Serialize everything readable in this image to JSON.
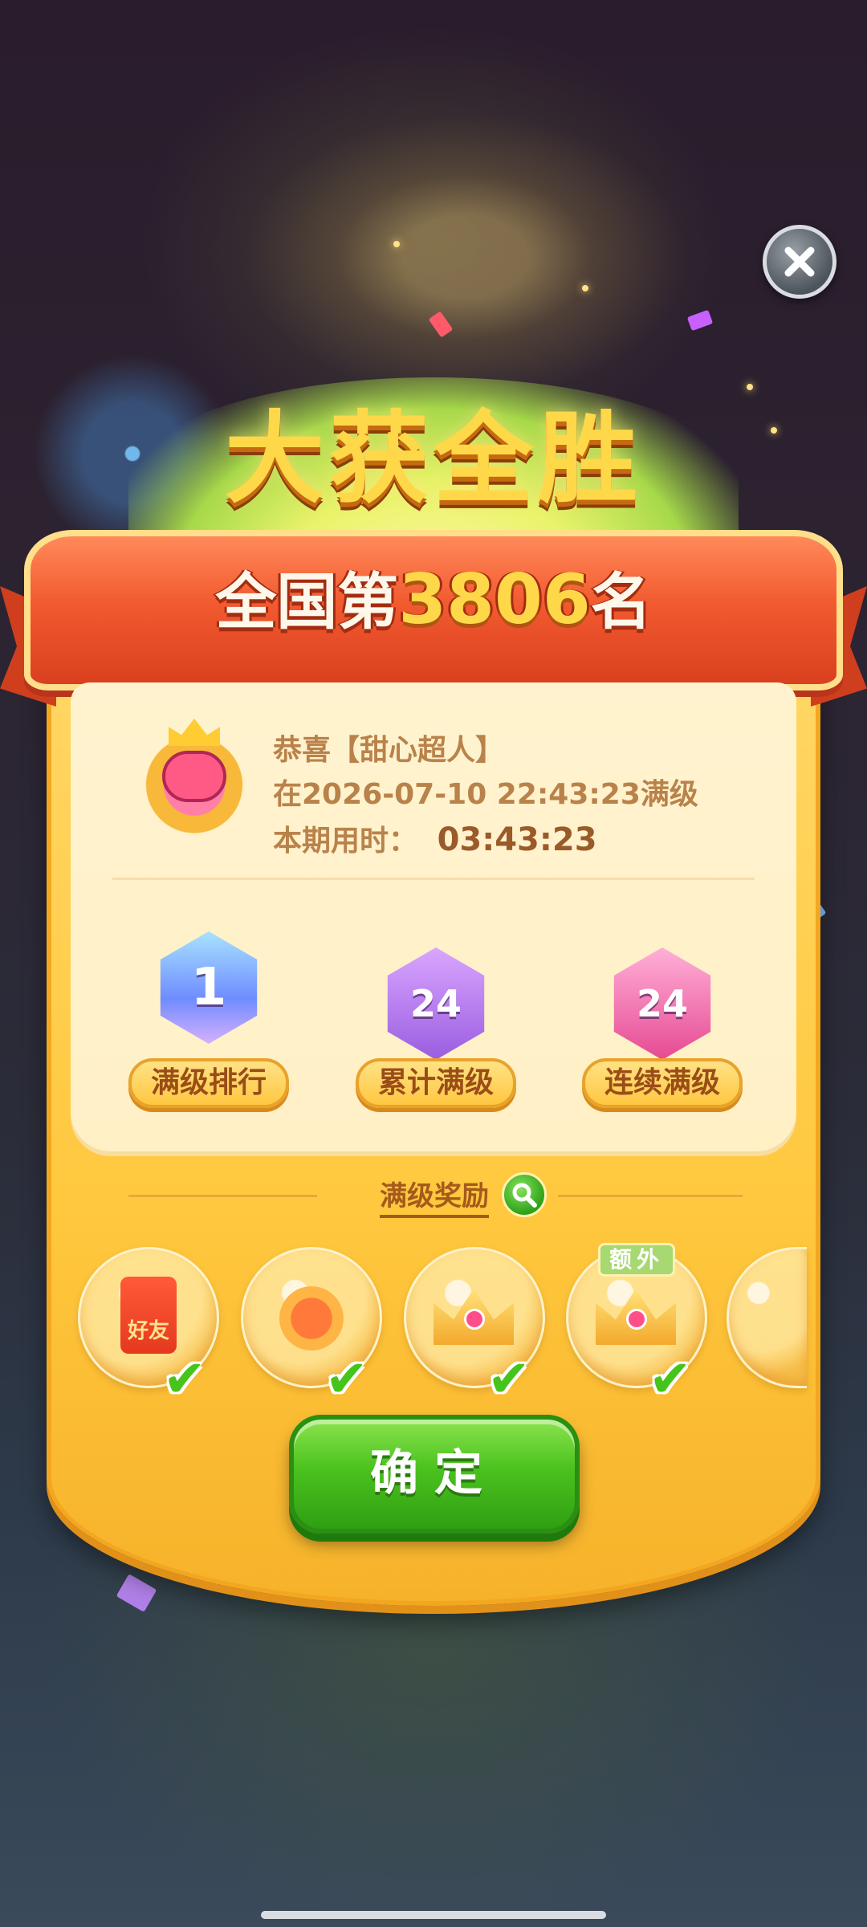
{
  "header": {
    "title": "大获全胜"
  },
  "rank": {
    "prefix": "全国第",
    "number": "3806",
    "suffix": "名"
  },
  "info": {
    "congrats": "恭喜【甜心超人】",
    "level_time": "在2026-07-10 22:43:23满级",
    "period_label": "本期用时：",
    "period_value": "03:43:23"
  },
  "badges": [
    {
      "label": "满级排行",
      "value": "1"
    },
    {
      "label": "累计满级",
      "value": "24"
    },
    {
      "label": "连续满级",
      "value": "24"
    }
  ],
  "rewards": {
    "title": "满级奖励",
    "items": [
      {
        "name": "好友",
        "checked": true
      },
      {
        "name": "",
        "checked": true
      },
      {
        "name": "",
        "checked": true
      },
      {
        "name": "",
        "checked": true,
        "tag": "额外"
      }
    ]
  },
  "confirm": {
    "label": "确定"
  },
  "icons": {
    "close": "close-icon",
    "search": "search-icon",
    "check": "check-icon"
  },
  "colors": {
    "banner": "#f25a30",
    "panel": "#ffc83e",
    "confirm": "#4bc21f",
    "title": "#ffd84a"
  }
}
